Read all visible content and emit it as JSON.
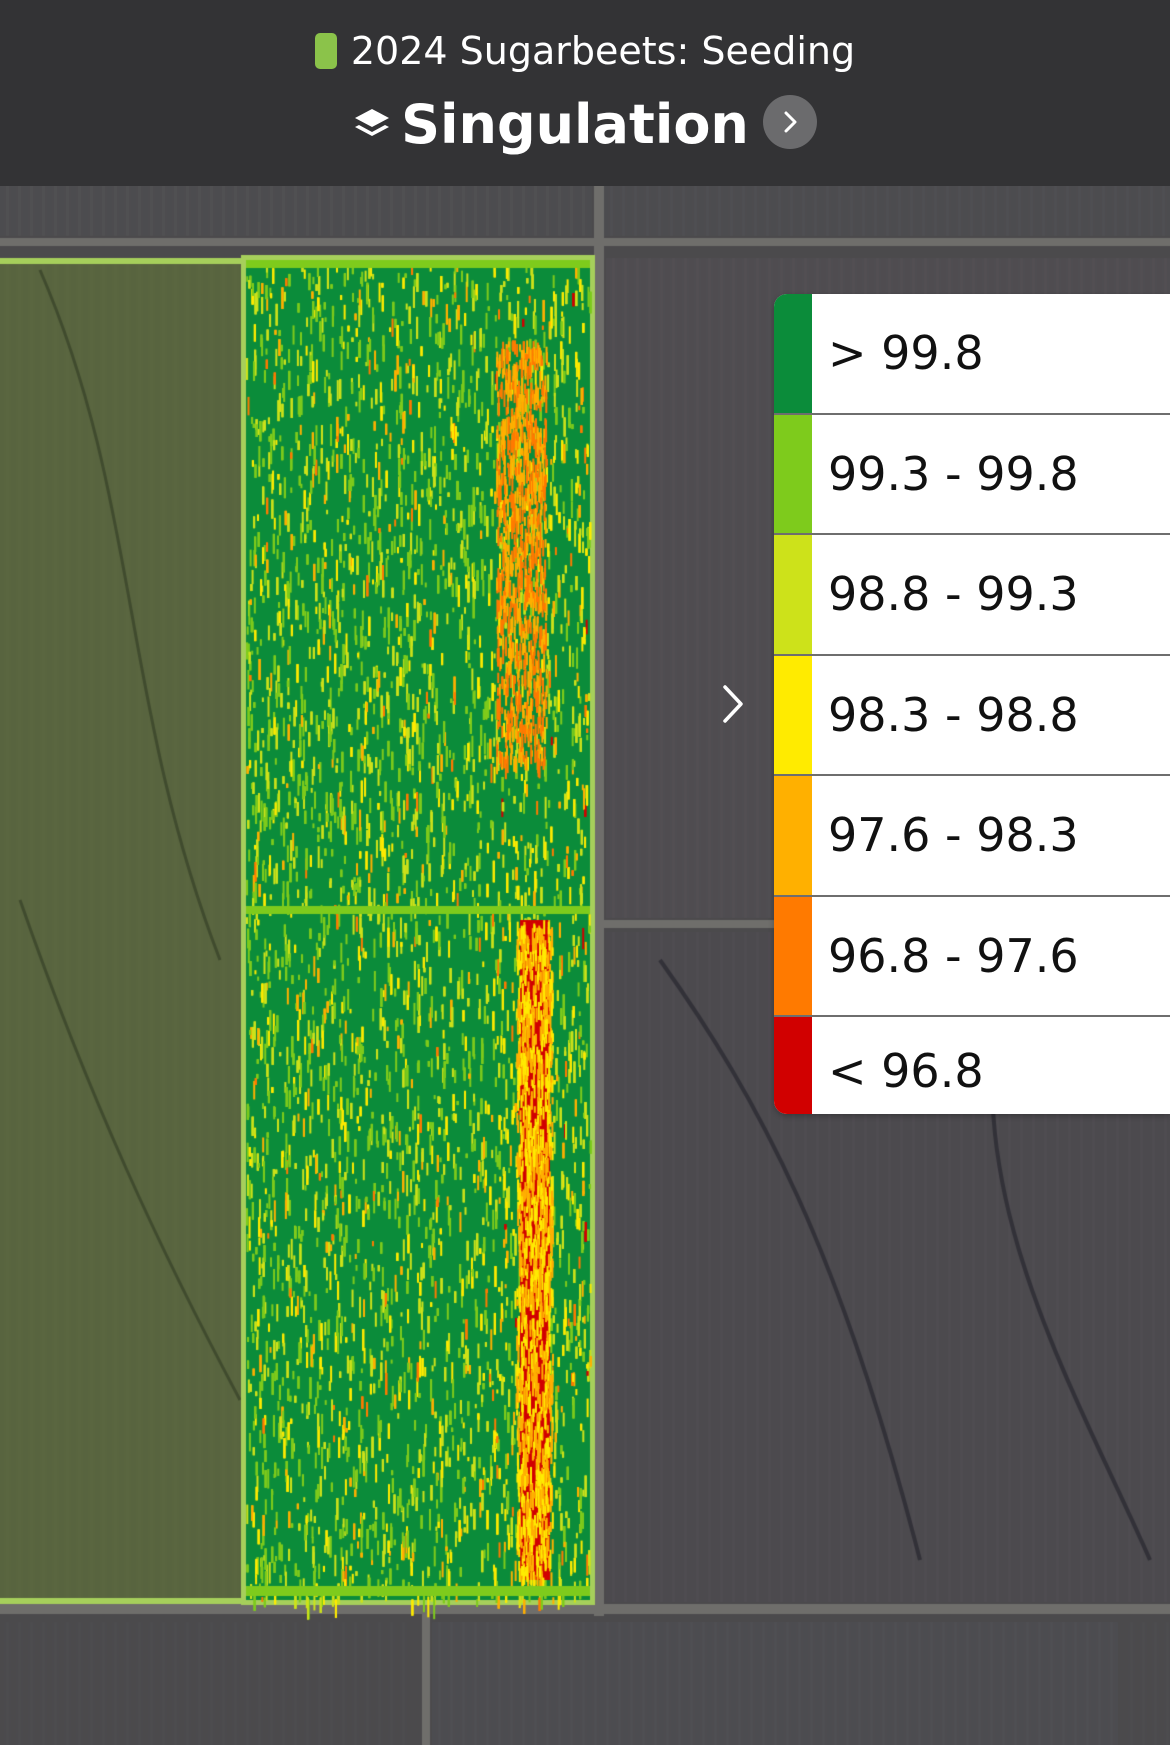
{
  "header": {
    "crop_layer": "2024 Sugarbeets: Seeding",
    "crop_color": "#8bc34a",
    "layer_title": "Singulation",
    "layer_icon": "layers-icon",
    "next_icon": "chevron-right-icon"
  },
  "map": {
    "type": "satellite-imagery",
    "overlay": "singulation-heatmap"
  },
  "legend": {
    "toggle_icon": "chevron-right-icon",
    "items": [
      {
        "label": "> 99.8",
        "color": "#0b8c3a"
      },
      {
        "label": "99.3 - 99.8",
        "color": "#7ecb1c"
      },
      {
        "label": "98.8 - 99.3",
        "color": "#cde21a"
      },
      {
        "label": "98.3 - 98.8",
        "color": "#ffeb00"
      },
      {
        "label": "97.6 - 98.3",
        "color": "#ffb000"
      },
      {
        "label": "96.8 - 97.6",
        "color": "#ff7a00"
      },
      {
        "label": "< 96.8",
        "color": "#d10000"
      }
    ]
  }
}
